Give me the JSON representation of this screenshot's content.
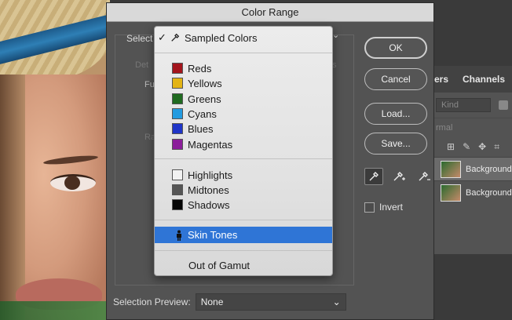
{
  "dialog": {
    "title": "Color Range",
    "select_label": "Select",
    "buttons": {
      "ok": "OK",
      "cancel": "Cancel",
      "load": "Load...",
      "save": "Save..."
    },
    "invert_label": "Invert",
    "preview_label": "Selection Preview:",
    "preview_value": "None",
    "hidden": {
      "detect": "Det",
      "fuzz": "Fu",
      "range": "Ra",
      "faces": "s"
    }
  },
  "menu": {
    "items": [
      {
        "label": "Sampled Colors",
        "checked": true,
        "color": null,
        "icon": "eyedropper-icon"
      },
      {
        "label": "Reds",
        "color": "#a3141c"
      },
      {
        "label": "Yellows",
        "color": "#e3b414"
      },
      {
        "label": "Greens",
        "color": "#1f6a1f"
      },
      {
        "label": "Cyans",
        "color": "#239be0"
      },
      {
        "label": "Blues",
        "color": "#1f35c8"
      },
      {
        "label": "Magentas",
        "color": "#8b1e9a"
      },
      {
        "label": "Highlights",
        "color": "#f2f2f2"
      },
      {
        "label": "Midtones",
        "color": "#555555"
      },
      {
        "label": "Shadows",
        "color": "#050505"
      },
      {
        "label": "Skin Tones",
        "icon": "person-icon",
        "highlighted": true
      },
      {
        "label": "Out of Gamut"
      }
    ]
  },
  "layers": {
    "tab_layers": "ers",
    "tab_channels": "Channels",
    "kind": "Kind",
    "mode": "rmal",
    "rows": [
      "Background",
      "Background"
    ]
  }
}
